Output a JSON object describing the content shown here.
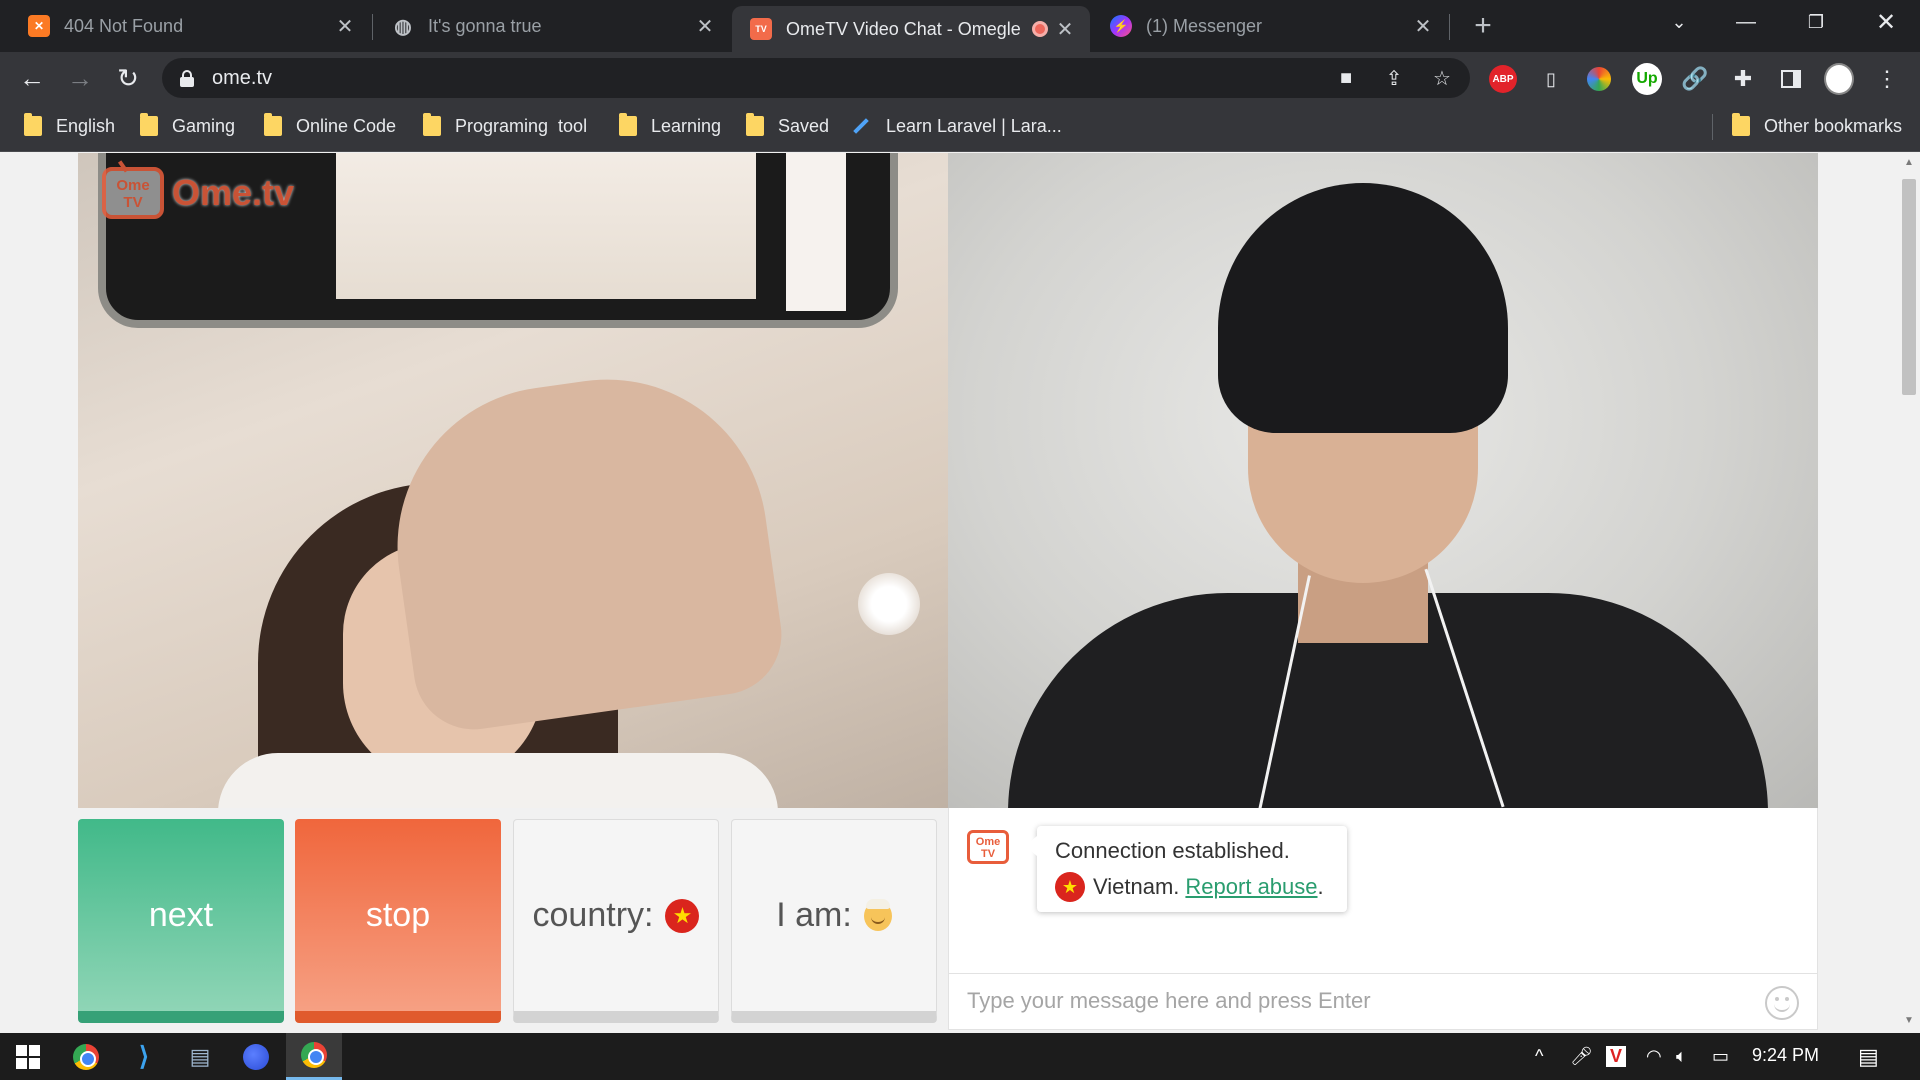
{
  "browser": {
    "tabs": [
      {
        "title": "404 Not Found",
        "icon": "xampp-icon",
        "active": false
      },
      {
        "title": "It's gonna true",
        "icon": "globe-icon",
        "active": false
      },
      {
        "title": "OmeTV Video Chat - Omegle",
        "icon": "ometv-icon",
        "active": true,
        "recording": true
      },
      {
        "title": "(1) Messenger",
        "icon": "messenger-icon",
        "active": false
      }
    ],
    "url": "ome.tv",
    "extensions": [
      "camera-icon",
      "share-icon",
      "star-icon",
      "abp-icon",
      "phone-icon",
      "color-picker-icon",
      "upwork-icon",
      "link-icon",
      "puzzle-icon",
      "sidepanel-icon",
      "profile-avatar",
      "menu-icon"
    ],
    "abp_label": "ABP",
    "upwork_label": "Up",
    "bookmarks": [
      {
        "label": "English",
        "type": "folder"
      },
      {
        "label": "Gaming",
        "type": "folder"
      },
      {
        "label": "Online Code",
        "type": "folder"
      },
      {
        "label": "Programing  tool",
        "type": "folder"
      },
      {
        "label": "Learning",
        "type": "folder"
      },
      {
        "label": "Saved",
        "type": "folder"
      },
      {
        "label": "Learn Laravel | Lara...",
        "type": "link"
      }
    ],
    "other_bookmarks": "Other bookmarks"
  },
  "ometv": {
    "logo_small_top": "Ome",
    "logo_small_bottom": "TV",
    "logo_text": "Ome.tv",
    "buttons": {
      "next": "next",
      "stop": "stop",
      "country": "country:",
      "iam": "I am:"
    },
    "chat": {
      "system_message": "Connection established.",
      "country": "Vietnam.",
      "report_link": "Report abuse",
      "report_suffix": ".",
      "input_placeholder": "Type your message here and press Enter"
    }
  },
  "taskbar": {
    "apps": [
      "windows-start",
      "chrome",
      "vscode",
      "file-explorer",
      "firefox",
      "chrome-active"
    ],
    "time": "9:24 PM"
  },
  "colors": {
    "next": "#41b989",
    "stop": "#f0663c",
    "brand": "#e85d3b",
    "link": "#2a9d6f"
  }
}
